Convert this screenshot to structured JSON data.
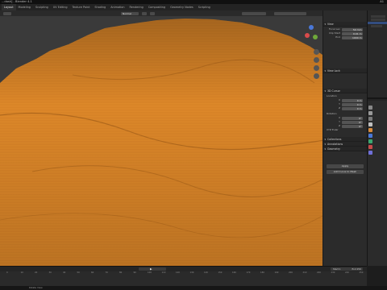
{
  "window": {
    "title": "...dash] - Blender 4.1",
    "right_text": "A1"
  },
  "tabs": [
    "Layout",
    "Modeling",
    "Sculpting",
    "UV Editing",
    "Texture Paint",
    "Shading",
    "Animation",
    "Rendering",
    "Compositing",
    "Geometry Nodes",
    "Scripting"
  ],
  "viewport": {
    "mode_label": "Normal",
    "gizmo_axes": [
      "X",
      "Y",
      "Z"
    ]
  },
  "npanel": {
    "sections": {
      "view": "View",
      "view_lock": "View Lock",
      "three_d_cursor": "3D Cursor",
      "location": "Location",
      "rotation": "Rotation",
      "collections": "Collections",
      "annotations": "Annotations",
      "geometry": "Geometry"
    },
    "view_rows": [
      {
        "label": "Focal Len",
        "value": "50 mm"
      },
      {
        "label": "Clip Start",
        "value": "0.01 m"
      },
      {
        "label": "End",
        "value": "1000 m"
      }
    ],
    "location_rows": [
      {
        "label": "X",
        "value": "0 m"
      },
      {
        "label": "Y",
        "value": "0 m"
      },
      {
        "label": "Z",
        "value": "0 m"
      }
    ],
    "rotation_rows": [
      {
        "label": "X",
        "value": "0°"
      },
      {
        "label": "Y",
        "value": "0°"
      },
      {
        "label": "Z",
        "value": "0°"
      }
    ],
    "rotation_mode": "XYZ Euler",
    "buttons": {
      "apply": "Apply",
      "add_convert": "Add Curve to Mesh"
    }
  },
  "timeline": {
    "ruler": [
      "0",
      "10",
      "20",
      "30",
      "40",
      "50",
      "60",
      "70",
      "80",
      "90",
      "100",
      "110",
      "120",
      "130",
      "140",
      "150",
      "160",
      "170",
      "180",
      "190",
      "200",
      "210",
      "220",
      "230",
      "240",
      "250"
    ],
    "start": "Start 1",
    "end": "End 250"
  },
  "status": {
    "text": "Rotate View"
  },
  "colors": {
    "mesh_orange": "#e08a2a",
    "mesh_shadow": "#8a4e12",
    "selection_blue": "#334d80",
    "viewport_bg": "#3a3a3a"
  },
  "icons": [
    "gizmo-x-icon",
    "gizmo-y-icon",
    "gizmo-z-icon",
    "zoom-icon",
    "pan-icon",
    "camera-icon",
    "perspective-icon",
    "play-icon"
  ]
}
